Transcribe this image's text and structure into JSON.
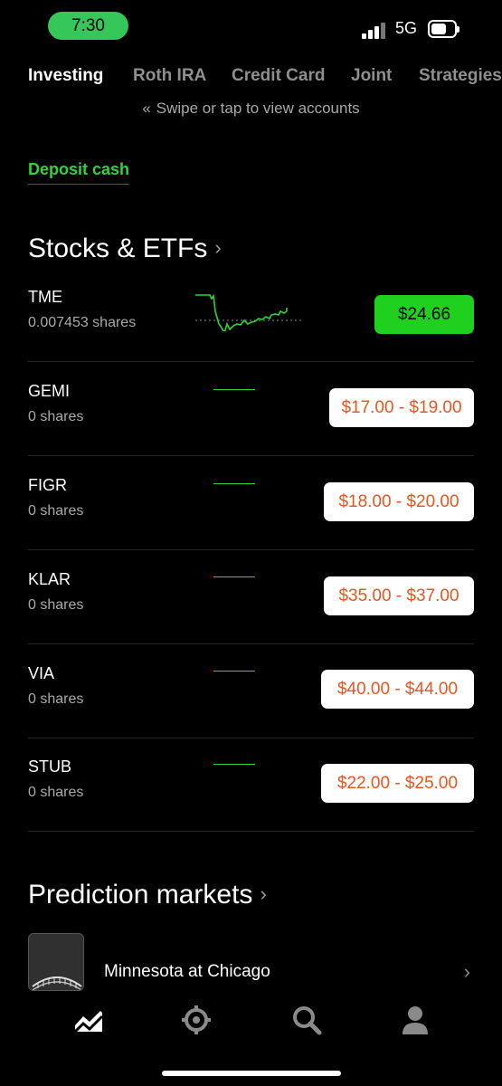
{
  "status_bar": {
    "time": "7:30",
    "network": "5G",
    "signal_icon": "cellular-signal-icon",
    "battery_icon": "battery-icon"
  },
  "accounts": {
    "tabs": [
      "Investing",
      "Roth IRA",
      "Credit Card",
      "Joint",
      "Strategies"
    ],
    "active": "Investing",
    "swipe_hint": "Swipe or tap to view accounts"
  },
  "deposit_label": "Deposit cash",
  "stocks_section": {
    "title": "Stocks & ETFs",
    "items": [
      {
        "ticker": "TME",
        "shares": "0.007453 shares",
        "price": "$24.66",
        "style": "green"
      },
      {
        "ticker": "GEMI",
        "shares": "0 shares",
        "price": "$17.00 - $19.00",
        "style": "white"
      },
      {
        "ticker": "FIGR",
        "shares": "0 shares",
        "price": "$18.00 - $20.00",
        "style": "white"
      },
      {
        "ticker": "KLAR",
        "shares": "0 shares",
        "price": "$35.00 - $37.00",
        "style": "white"
      },
      {
        "ticker": "VIA",
        "shares": "0 shares",
        "price": "$40.00 - $44.00",
        "style": "white"
      },
      {
        "ticker": "STUB",
        "shares": "0 shares",
        "price": "$22.00 - $25.00",
        "style": "white"
      }
    ]
  },
  "prediction_section": {
    "title": "Prediction markets",
    "items": [
      {
        "title": "Minnesota at Chicago"
      }
    ]
  },
  "bottom_nav": {
    "items": [
      "chart-icon",
      "crypto-icon",
      "search-icon",
      "account-icon"
    ]
  },
  "colors": {
    "accent_green": "#1fd01f",
    "price_orange": "#e8561e",
    "background": "#000000"
  }
}
